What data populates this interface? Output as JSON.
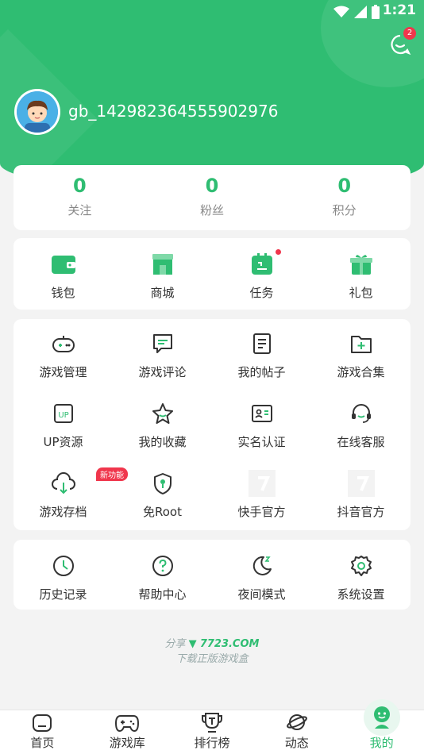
{
  "status_bar": {
    "time": "1:21"
  },
  "header": {
    "message_badge": "2",
    "username": "gb_142982364555902976"
  },
  "stats": [
    {
      "value": "0",
      "label": "关注"
    },
    {
      "value": "0",
      "label": "粉丝"
    },
    {
      "value": "0",
      "label": "积分"
    }
  ],
  "wallet_row": [
    {
      "label": "钱包",
      "icon": "wallet-icon"
    },
    {
      "label": "商城",
      "icon": "shop-icon"
    },
    {
      "label": "任务",
      "icon": "task-icon"
    },
    {
      "label": "礼包",
      "icon": "gift-icon"
    }
  ],
  "tools": [
    {
      "label": "游戏管理",
      "icon": "gamepad-icon"
    },
    {
      "label": "游戏评论",
      "icon": "comment-icon"
    },
    {
      "label": "我的帖子",
      "icon": "post-icon"
    },
    {
      "label": "游戏合集",
      "icon": "folder-add-icon"
    },
    {
      "label": "UP资源",
      "icon": "up-icon"
    },
    {
      "label": "我的收藏",
      "icon": "star-icon"
    },
    {
      "label": "实名认证",
      "icon": "id-card-icon"
    },
    {
      "label": "在线客服",
      "icon": "headset-icon"
    },
    {
      "label": "游戏存档",
      "icon": "cloud-download-icon"
    },
    {
      "label": "免Root",
      "icon": "shield-icon"
    },
    {
      "label": "快手官方",
      "icon": "kuaishou-placeholder-icon"
    },
    {
      "label": "抖音官方",
      "icon": "douyin-placeholder-icon"
    }
  ],
  "new_tag": "新功能",
  "others": [
    {
      "label": "历史记录",
      "icon": "clock-icon"
    },
    {
      "label": "帮助中心",
      "icon": "help-icon"
    },
    {
      "label": "夜间模式",
      "icon": "moon-icon"
    },
    {
      "label": "系统设置",
      "icon": "gear-icon"
    }
  ],
  "share": {
    "prefix": "分享",
    "brand": "7723.COM",
    "sub": "下载正版游戏盒"
  },
  "tabs": [
    {
      "label": "首页",
      "icon": "home-icon"
    },
    {
      "label": "游戏库",
      "icon": "gamepad-icon"
    },
    {
      "label": "排行榜",
      "icon": "trophy-icon"
    },
    {
      "label": "动态",
      "icon": "planet-icon"
    },
    {
      "label": "我的",
      "icon": "profile-icon"
    }
  ],
  "colors": {
    "primary": "#2fbd72",
    "badge": "#f0364c",
    "background": "#f3f3f3"
  }
}
